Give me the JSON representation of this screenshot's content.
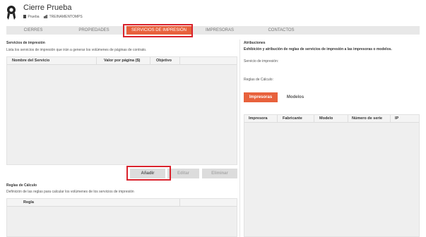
{
  "header": {
    "title": "Cierre Prueba",
    "crumbs": [
      "Prueba",
      "TREINAMENTOMPS"
    ]
  },
  "tabs": [
    {
      "label": "CIERRES",
      "active": false
    },
    {
      "label": "PROPIEDADES",
      "active": false
    },
    {
      "label": "SERVICIOS DE IMPRESIÓN",
      "active": true
    },
    {
      "label": "IMPRESORAS",
      "active": false
    },
    {
      "label": "CONTACTOS",
      "active": false
    }
  ],
  "services": {
    "title": "Servicios de impresión",
    "description": "Lista los servicios de impresión que irán a generar los volúmenes de páginas de contrato.",
    "columns": [
      "Nombre del Servicio",
      "Valor por página ($)",
      "Objetivo"
    ],
    "buttons": {
      "add": "Añadir",
      "edit": "Editar",
      "delete": "Eliminar"
    }
  },
  "rules": {
    "title": "Reglas de Cálculo",
    "description": "Definición de las reglas para calcular los volúmenes de los servicios de impresión",
    "columns": [
      "Regla"
    ]
  },
  "attributions": {
    "title": "Atribuciones",
    "subtitle": "Exhibición y atribución de reglas de servicios de impresión a las impresoras o modelos.",
    "service_label": "Servicio de impresión:",
    "rules_label": "Reglas de Cálculo:",
    "subtabs": [
      {
        "label": "Impresoras",
        "active": true
      },
      {
        "label": "Modelos",
        "active": false
      }
    ],
    "columns": [
      "Impresora",
      "Fabricante",
      "Modelo",
      "Número de serie",
      "IP"
    ]
  },
  "colors": {
    "accent": "#e8613c",
    "highlight": "#d9232d"
  }
}
